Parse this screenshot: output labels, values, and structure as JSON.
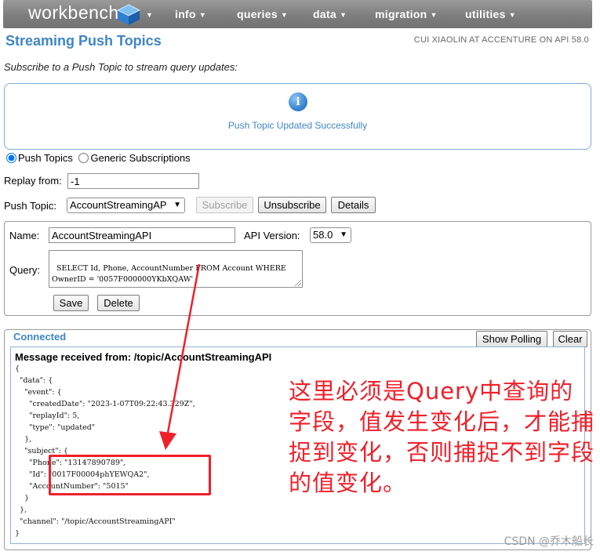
{
  "nav": {
    "logo": "workbench",
    "items": [
      "info",
      "queries",
      "data",
      "migration",
      "utilities"
    ]
  },
  "header": {
    "title": "Streaming Push Topics",
    "user": "CUI XIAOLIN AT ACCENTURE ON API 58.0",
    "subtitle": "Subscribe to a Push Topic to stream query updates:"
  },
  "info": {
    "message": "Push Topic Updated Successfully"
  },
  "mode": {
    "push_topics": "Push Topics",
    "generic": "Generic Subscriptions"
  },
  "replay": {
    "label": "Replay from:",
    "value": "-1"
  },
  "push_topic": {
    "label": "Push Topic:",
    "selected": "AccountStreamingAP",
    "subscribe": "Subscribe",
    "unsubscribe": "Unsubscribe",
    "details": "Details"
  },
  "topic_form": {
    "name_label": "Name:",
    "name_value": "AccountStreamingAPI",
    "api_label": "API Version:",
    "api_value": "58.0",
    "query_label": "Query:",
    "query_value": "SELECT Id, Phone, AccountNumber FROM Account WHERE\nOwnerID = '0057F000000YKbXQAW'",
    "save": "Save",
    "delete": "Delete"
  },
  "stream": {
    "status": "Connected",
    "show_polling": "Show Polling",
    "clear": "Clear",
    "message_header": "Message received from: /topic/AccountStreamingAPI",
    "json_lines": [
      "{",
      "  \"data\": {",
      "    \"event\": {",
      "      \"createdDate\": \"2023-1-07T09:22:43.329Z\",",
      "      \"replayId\": 5,",
      "      \"type\": \"updated\"",
      "    },",
      "    \"subject\": {",
      "      \"Phone\": \"13147890789\",",
      "      \"Id\": \"0017F00004phYEWQA2\",",
      "      \"AccountNumber\": \"5015\"",
      "    }",
      "  },",
      "  \"channel\": \"/topic/AccountStreamingAPI\"",
      "}"
    ]
  },
  "annotation": {
    "text": "这里必须是Query中查询的字段，值发生变化后，才能捕捉到变化，否则捕捉不到字段的值变化。",
    "color": "#f0202a"
  },
  "watermark": "CSDN @乔木船长",
  "colors": {
    "accent": "#3e86c8",
    "nav_bg": "#808080"
  }
}
